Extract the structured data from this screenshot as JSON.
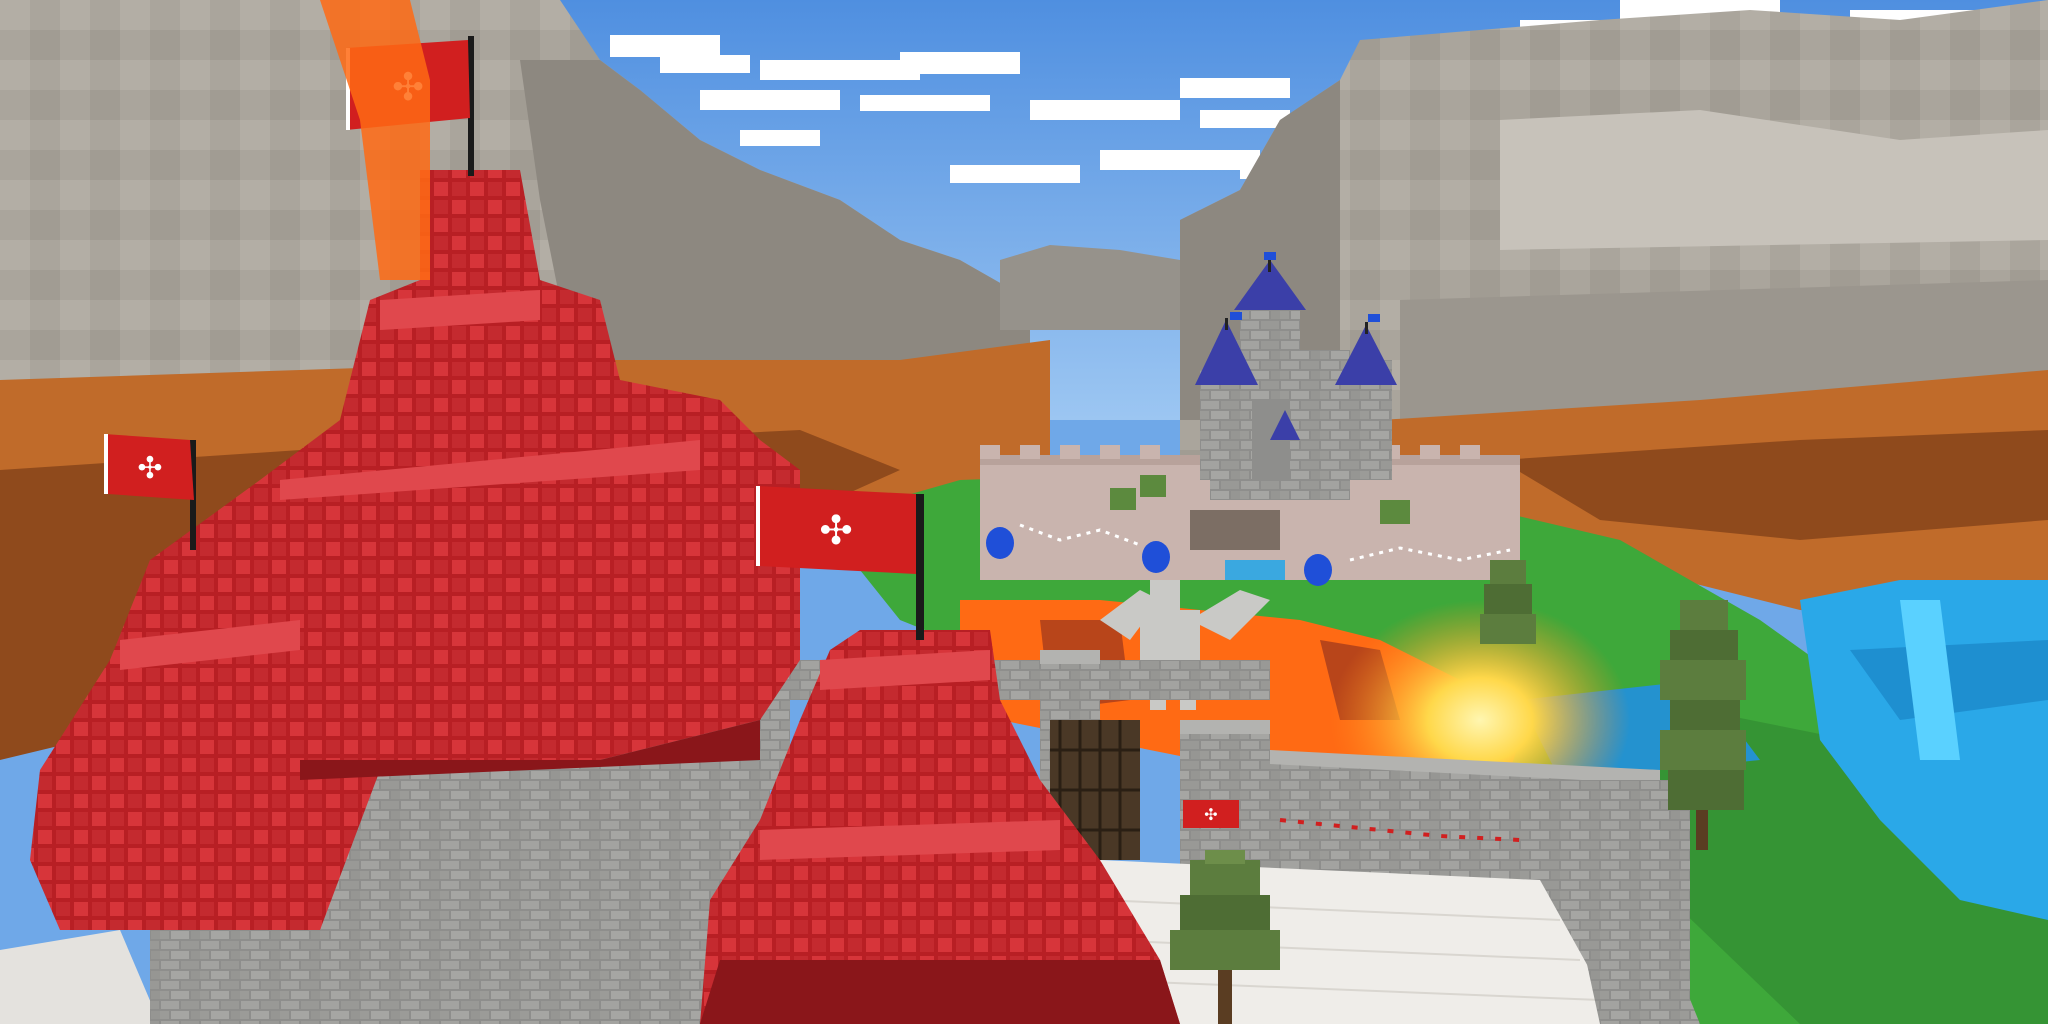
{
  "scene": {
    "type": "voxel-game-screenshot",
    "colors": {
      "sky_top": "#4f8fe0",
      "sky_bottom": "#9cc6f2",
      "cloud": "#ffffff",
      "mountain_light": "#b4aea5",
      "mountain_dark": "#8d8880",
      "dirt": "#c06b2a",
      "dirt_dark": "#8f4a1c",
      "grass": "#3ea83a",
      "lava": "#ff6a14",
      "lava_glow": "#ffd84a",
      "water": "#2aa8e8",
      "stone": "#9a9a98",
      "stone_dark": "#6e6e6c",
      "castle_wall": "#c9b4ae",
      "castle_roof": "#3b3fa8",
      "red_block": "#c9262a",
      "banner_red": "#d11f1f",
      "banner_emblem": "#ffffff",
      "tree": "#5c7d3e",
      "shield_blue": "#1f4fd8"
    }
  }
}
